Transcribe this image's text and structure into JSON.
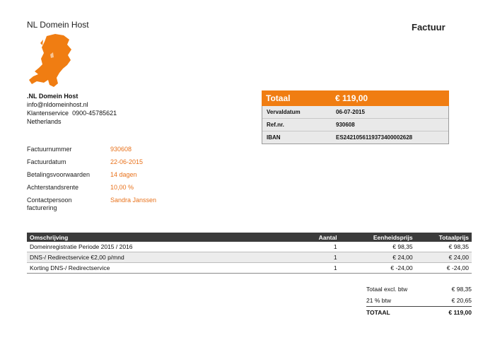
{
  "header": {
    "brand": "NL Domein Host",
    "doc_title": "Factuur"
  },
  "company": {
    "name": ".NL Domein Host",
    "email": "info@nldomeinhost.nl",
    "service_label": "Klantenservice",
    "service_phone": "0900-45785621",
    "country": "Netherlands"
  },
  "total_box": {
    "label": "Totaal",
    "amount": "€ 119,00",
    "rows": [
      {
        "label": "Vervaldatum",
        "value": "06-07-2015"
      },
      {
        "label": "Ref.nr.",
        "value": "930608"
      },
      {
        "label": "IBAN",
        "value": "ES2421056119373400002628"
      }
    ]
  },
  "info": [
    {
      "label": "Factuurnummer",
      "value": "930608"
    },
    {
      "label": "Factuurdatum",
      "value": "22-06-2015"
    },
    {
      "label": "Betalingsvoorwaarden",
      "value": "14 dagen"
    },
    {
      "label": "Achterstandsrente",
      "value": "10,00 %"
    },
    {
      "label": "Contactpersoon facturering",
      "value": "Sandra Janssen"
    }
  ],
  "items": {
    "headers": {
      "desc": "Omschrijving",
      "qty": "Aantal",
      "unit": "Eenheidsprijs",
      "total": "Totaalprijs"
    },
    "rows": [
      {
        "desc": "Domeinregistratie Periode 2015 / 2016",
        "qty": "1",
        "unit": "€ 98,35",
        "total": "€ 98,35"
      },
      {
        "desc": "DNS-/ Redirectservice €2,00 p/mnd",
        "qty": "1",
        "unit": "€ 24,00",
        "total": "€ 24,00"
      },
      {
        "desc": "Korting DNS-/ Redirectservice",
        "qty": "1",
        "unit": "€ -24,00",
        "total": "€ -24,00"
      }
    ]
  },
  "summary": [
    {
      "label": "Totaal excl. btw",
      "value": "€ 98,35"
    },
    {
      "label": "21 % btw",
      "value": "€ 20,65"
    },
    {
      "label": "TOTAAL",
      "value": "€ 119,00"
    }
  ],
  "colors": {
    "accent": "#f07d12",
    "table_header": "#3b3b3b"
  }
}
